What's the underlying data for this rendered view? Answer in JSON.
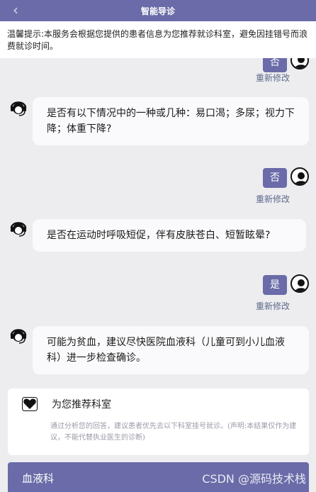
{
  "header": {
    "title": "智能导诊",
    "back_icon": "chevron-left-icon"
  },
  "notice": {
    "text": "温馨提示:本服务会根据您提供的患者信息为您推荐就诊科室，避免因挂错号而浪费就诊时间。"
  },
  "edit_label": "重新修改",
  "messages": [
    {
      "from": "user",
      "text": "否"
    },
    {
      "from": "bot",
      "text": "是否有以下情况中的一种或几种：易口渴；多尿；视力下降；体重下降?"
    },
    {
      "from": "user",
      "text": "否"
    },
    {
      "from": "bot",
      "text": "是否在运动时呼吸短促，伴有皮肤苍白、短暂眩晕?"
    },
    {
      "from": "user",
      "text": "是"
    },
    {
      "from": "bot",
      "text": "可能为贫血，建议尽快医院血液科（儿童可到小儿血液科）进一步检查确诊。"
    }
  ],
  "recommendation": {
    "title": "为您推荐科室",
    "description": "通过分析您的回答，建议患者优先去以下科室挂号就诊。(声明:本结果仅作为建议，不能代替执业医生的诊断)",
    "icon": "heart-icon"
  },
  "department": {
    "name": "血液科"
  },
  "watermark": "CSDN @源码技术栈",
  "colors": {
    "accent": "#6a6ba8",
    "background": "#ededf0",
    "edit_link": "#5d6a8a"
  }
}
